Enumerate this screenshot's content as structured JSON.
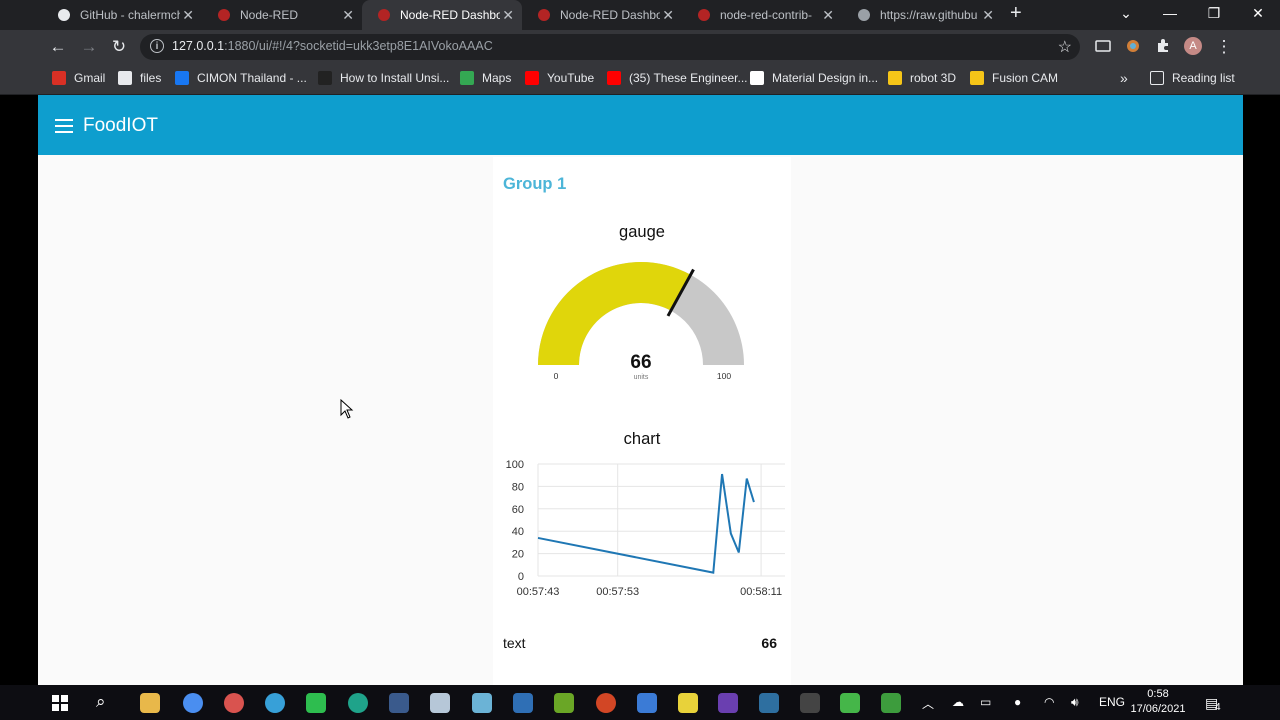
{
  "browser": {
    "tabs": [
      {
        "title": "GitHub - chalermch",
        "icon": "github-icon",
        "active": false
      },
      {
        "title": "Node-RED",
        "icon": "node-red-icon",
        "active": false
      },
      {
        "title": "Node-RED Dashboa",
        "icon": "node-red-icon",
        "active": true
      },
      {
        "title": "Node-RED Dashboa",
        "icon": "node-red-icon",
        "active": false
      },
      {
        "title": "node-red-contrib-",
        "icon": "node-red-icon",
        "active": false
      },
      {
        "title": "https://raw.githubu",
        "icon": "globe-icon",
        "active": false
      }
    ],
    "url_host": "127.0.0.1",
    "url_rest": ":1880/ui/#!/4?socketid=ukk3etp8E1AIVokoAAAC",
    "profile_initial": "A",
    "bookmarks": [
      {
        "label": "Gmail"
      },
      {
        "label": "files"
      },
      {
        "label": "CIMON Thailand - ..."
      },
      {
        "label": "How to Install Unsi..."
      },
      {
        "label": "Maps"
      },
      {
        "label": "YouTube"
      },
      {
        "label": "(35) These Engineer..."
      },
      {
        "label": "Material Design in..."
      },
      {
        "label": "robot 3D"
      },
      {
        "label": "Fusion CAM"
      }
    ],
    "reading_list": "Reading list",
    "overflow": "»"
  },
  "dashboard": {
    "title": "FoodIOT",
    "header_color": "#0e9ece",
    "group_title": "Group 1",
    "gauge": {
      "label": "gauge",
      "value": 66,
      "min": 0,
      "max": 100,
      "units": "units",
      "min_label": "0",
      "max_label": "100",
      "fill_color": "#e0d60b",
      "track_color": "#c8c8c8"
    },
    "chart_label": "chart",
    "text_widget": {
      "label": "text",
      "value": "66"
    }
  },
  "chart_data": {
    "type": "line",
    "title": "chart",
    "xlabel": "",
    "ylabel": "",
    "x_tick_labels": [
      "00:57:43",
      "00:57:53",
      "00:58:11"
    ],
    "x_ticks_seconds": [
      0,
      10,
      28
    ],
    "y_ticks": [
      0,
      20,
      40,
      60,
      80,
      100
    ],
    "ylim": [
      0,
      100
    ],
    "xlim_seconds": [
      0,
      31
    ],
    "grid": true,
    "series": [
      {
        "color": "#1f77b4",
        "x_seconds": [
          0,
          22,
          23.1,
          24.2,
          25.2,
          26.2,
          27.1
        ],
        "y": [
          34,
          3,
          91,
          38,
          21,
          87,
          66
        ]
      }
    ]
  },
  "taskbar": {
    "time": "0:58",
    "date": "17/06/2021",
    "language": "ENG",
    "notification_count": "4"
  }
}
